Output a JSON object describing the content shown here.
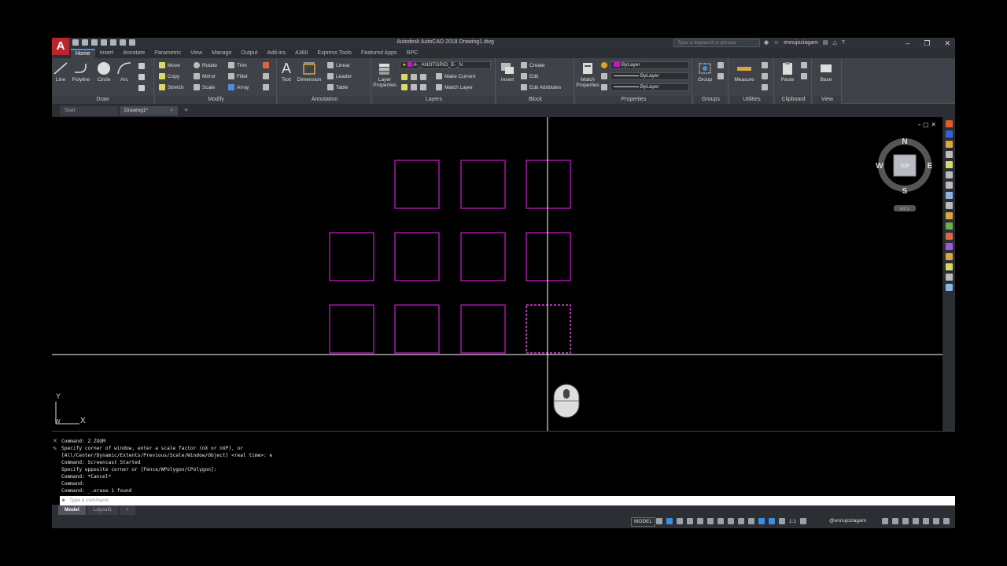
{
  "titlebar": {
    "app_logo": "A",
    "title": "Autodesk AutoCAD 2018   Drawing1.dwg",
    "search_placeholder": "Type a keyword or phrase",
    "user": "ennujoziagam",
    "help": "?"
  },
  "ribbon_tabs": [
    "Home",
    "Insert",
    "Annotate",
    "Parametric",
    "View",
    "Manage",
    "Output",
    "Add-ins",
    "A360",
    "Express Tools",
    "Featured Apps",
    "RPC"
  ],
  "ribbon": {
    "draw": {
      "title": "Draw",
      "line": "Line",
      "polyline": "Polyline",
      "circle": "Circle",
      "arc": "Arc"
    },
    "modify": {
      "title": "Modify",
      "move": "Move",
      "rotate": "Rotate",
      "trim": "Trim",
      "copy": "Copy",
      "mirror": "Mirror",
      "fillet": "Fillet",
      "stretch": "Stretch",
      "scale": "Scale",
      "array": "Array"
    },
    "annotation": {
      "title": "Annotation",
      "text": "Text",
      "dimension": "Dimension",
      "linear": "Linear",
      "leader": "Leader",
      "table": "Table",
      "text_icon": "A"
    },
    "layers": {
      "title": "Layers",
      "layer_properties_1": "Layer",
      "layer_properties_2": "Properties",
      "current_layer": "A-_ANOTGRID_E-_N",
      "make_current": "Make Current",
      "match_layer": "Match Layer"
    },
    "block": {
      "title": "Block",
      "insert": "Insert",
      "create": "Create",
      "edit": "Edit",
      "edit_attributes": "Edit Attributes"
    },
    "properties": {
      "title": "Properties",
      "match_1": "Match",
      "match_2": "Properties",
      "color": "ByLayer",
      "linetype": "ByLayer",
      "lineweight": "ByLayer"
    },
    "groups": {
      "title": "Groups",
      "group": "Group"
    },
    "utilities": {
      "title": "Utilities",
      "measure": "Measure"
    },
    "clipboard": {
      "title": "Clipboard",
      "paste": "Paste"
    },
    "view": {
      "title": "View",
      "base": "Base"
    }
  },
  "file_tabs": [
    {
      "label": "Start"
    },
    {
      "label": "Drawing1*"
    }
  ],
  "file_tab_add": "+",
  "viewcube": {
    "n": "N",
    "s": "S",
    "e": "E",
    "w": "W",
    "top": "TOP",
    "wcs": "WCS"
  },
  "ucs": {
    "x": "X",
    "y": "Y",
    "w": "W"
  },
  "viewport_controls": "– □ ✕",
  "command_history": [
    "Command: Z ZOOM",
    "Specify corner of window, enter a scale factor (nX or nXP), or",
    "[All/Center/Dynamic/Extents/Previous/Scale/Window/Object] <real time>: e",
    "Command: Screencast Started",
    "Specify opposite corner or [Fence/WPolygon/CPolygon]:",
    "Command: *Cancel*",
    "Command:",
    "Command: _.erase 1 found"
  ],
  "command_placeholder": "Type a command",
  "layout_tabs": [
    {
      "label": "Model"
    },
    {
      "label": "Layout1"
    }
  ],
  "layout_add": "+",
  "status": {
    "model": "MODEL",
    "user": "@ennujoziagam",
    "scale": "1:1"
  },
  "colors": {
    "shape": "#c21ac2",
    "selected": "#e040e0",
    "crosshair": "#ffffff",
    "accent": "#4a90d9"
  }
}
